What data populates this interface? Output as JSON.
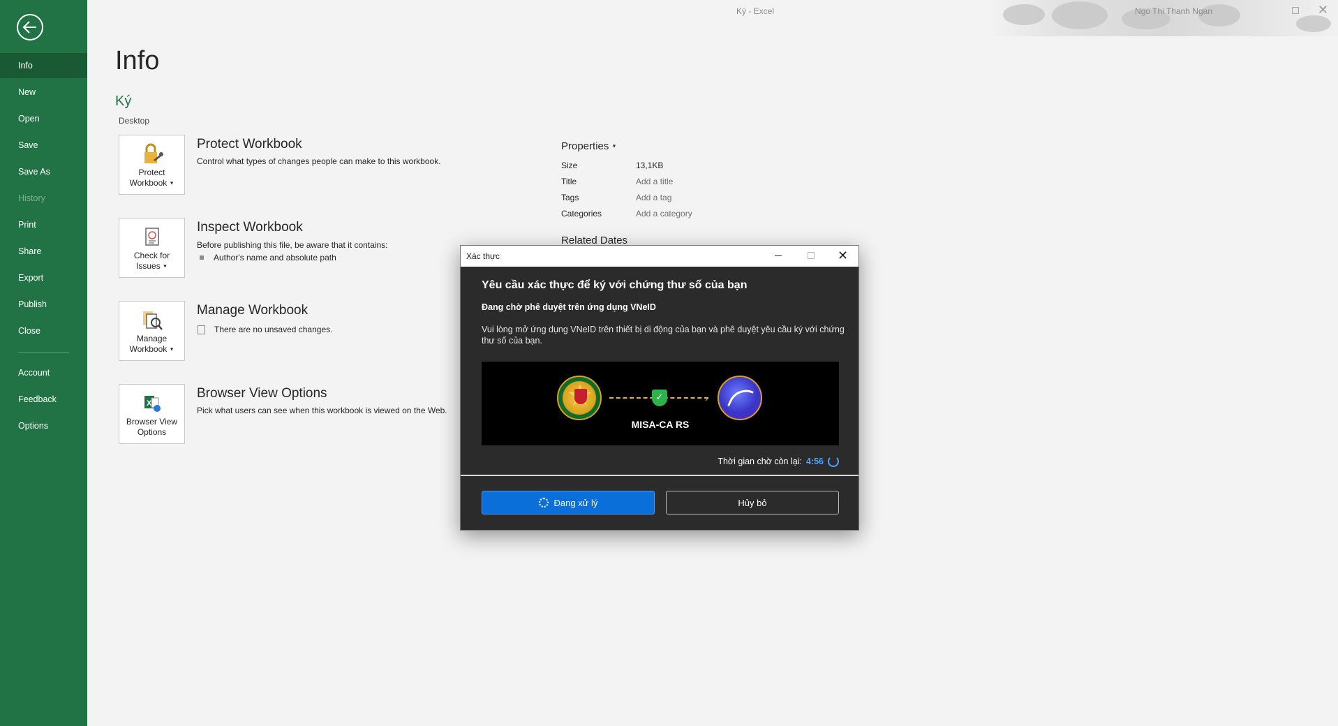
{
  "window": {
    "title": "Ký  -  Excel",
    "user": "Ngo Thi Thanh Ngan"
  },
  "sidebar": {
    "items": [
      {
        "label": "Info",
        "name": "info"
      },
      {
        "label": "New",
        "name": "new"
      },
      {
        "label": "Open",
        "name": "open"
      },
      {
        "label": "Save",
        "name": "save"
      },
      {
        "label": "Save As",
        "name": "save-as"
      },
      {
        "label": "History",
        "name": "history"
      },
      {
        "label": "Print",
        "name": "print"
      },
      {
        "label": "Share",
        "name": "share"
      },
      {
        "label": "Export",
        "name": "export"
      },
      {
        "label": "Publish",
        "name": "publish"
      },
      {
        "label": "Close",
        "name": "close"
      },
      {
        "label": "Account",
        "name": "account"
      },
      {
        "label": "Feedback",
        "name": "feedback"
      },
      {
        "label": "Options",
        "name": "options"
      }
    ]
  },
  "page": {
    "title": "Info",
    "file_name": "Ký",
    "file_location": "Desktop"
  },
  "sections": {
    "protect": {
      "button_line1": "Protect",
      "button_line2": "Workbook",
      "title": "Protect Workbook",
      "desc": "Control what types of changes people can make to this workbook."
    },
    "inspect": {
      "button_line1": "Check for",
      "button_line2": "Issues",
      "title": "Inspect Workbook",
      "desc": "Before publishing this file, be aware that it contains:",
      "bullet": "Author's name and absolute path"
    },
    "manage": {
      "button_line1": "Manage",
      "button_line2": "Workbook",
      "title": "Manage Workbook",
      "note": "There are no unsaved changes."
    },
    "browser": {
      "button_line1": "Browser View",
      "button_line2": "Options",
      "title": "Browser View Options",
      "desc": "Pick what users can see when this workbook is viewed on the Web."
    }
  },
  "properties": {
    "header": "Properties",
    "rows": [
      {
        "key": "Size",
        "value": "13,1KB"
      },
      {
        "key": "Title",
        "value": "Add a title"
      },
      {
        "key": "Tags",
        "value": "Add a tag"
      },
      {
        "key": "Categories",
        "value": "Add a category"
      }
    ],
    "related_dates": "Related Dates"
  },
  "dialog": {
    "title": "Xác thực",
    "heading": "Yêu cầu xác thực để ký với chứng thư số của bạn",
    "subheading": "Đang chờ phê duyệt trên ứng dụng VNeID",
    "message": "Vui lòng mở ứng dụng VNeID trên thiết bị di động của bạn và phê duyệt yêu cầu ký với chứng thư số của bạn.",
    "banner_label": "MISA-CA RS",
    "timer_label": "Thời gian chờ còn lại:",
    "timer_value": "4:56",
    "primary_button": "Đang xử lý",
    "cancel_button": "Hủy bỏ"
  }
}
